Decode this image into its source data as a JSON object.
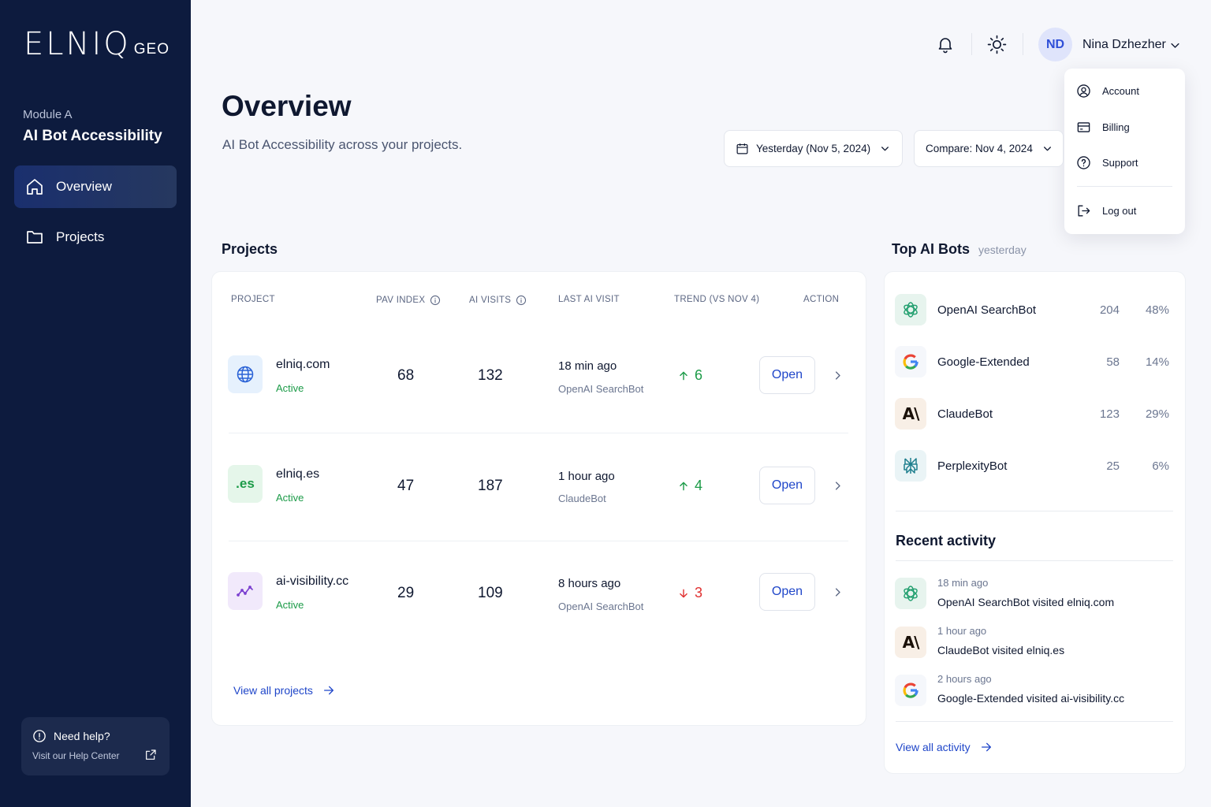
{
  "brand": {
    "logo_main": "ELNIQ",
    "logo_sub": "GEO"
  },
  "sidebar": {
    "module_label": "Module A",
    "module_title": "AI Bot Accessibility",
    "items": [
      {
        "label": "Overview",
        "icon": "home-icon",
        "active": true
      },
      {
        "label": "Projects",
        "icon": "folder-icon",
        "active": false
      }
    ],
    "help": {
      "title": "Need help?",
      "subtitle": "Visit our Help Center"
    }
  },
  "header": {
    "user_initials": "ND",
    "user_name": "Nina Dzhezher",
    "menu": [
      {
        "label": "Account",
        "icon": "user-circle-icon"
      },
      {
        "label": "Billing",
        "icon": "credit-card-icon"
      },
      {
        "label": "Support",
        "icon": "help-circle-icon"
      },
      {
        "label": "Log out",
        "icon": "logout-icon"
      }
    ]
  },
  "page": {
    "title": "Overview",
    "subtitle": "AI Bot Accessibility across your projects.",
    "date_selector": "Yesterday (Nov 5, 2024)",
    "compare_selector": "Compare: Nov 4, 2024"
  },
  "projects": {
    "title": "Projects",
    "columns": [
      "PROJECT",
      "PAV INDEX",
      "AI VISITS",
      "LAST AI VISIT",
      "TREND (VS NOV 4)",
      "ACTION"
    ],
    "rows": [
      {
        "name": "elniq.com",
        "status": "Active",
        "pav_index": "68",
        "ai_visits": "132",
        "last_visit": "18 min ago",
        "last_bot": "OpenAI SearchBot",
        "trend": "6",
        "trend_dir": "up",
        "action": "Open",
        "icon": "globe-icon",
        "icon_text": ""
      },
      {
        "name": "elniq.es",
        "status": "Active",
        "pav_index": "47",
        "ai_visits": "187",
        "last_visit": "1 hour ago",
        "last_bot": "ClaudeBot",
        "trend": "4",
        "trend_dir": "up",
        "action": "Open",
        "icon": "es-icon",
        "icon_text": ".es"
      },
      {
        "name": "ai-visibility.cc",
        "status": "Active",
        "pav_index": "29",
        "ai_visits": "109",
        "last_visit": "8 hours ago",
        "last_bot": "OpenAI SearchBot",
        "trend": "3",
        "trend_dir": "down",
        "action": "Open",
        "icon": "trend-line-icon",
        "icon_text": ""
      }
    ],
    "view_all": "View all projects"
  },
  "top_bots": {
    "title": "Top AI Bots",
    "hint": "yesterday",
    "rows": [
      {
        "name": "OpenAI SearchBot",
        "count": "204",
        "pct": "48%",
        "icon": "openai-icon"
      },
      {
        "name": "Google-Extended",
        "count": "58",
        "pct": "14%",
        "icon": "google-icon"
      },
      {
        "name": "ClaudeBot",
        "count": "123",
        "pct": "29%",
        "icon": "anthropic-icon",
        "icon_text": "A\\"
      },
      {
        "name": "PerplexityBot",
        "count": "25",
        "pct": "6%",
        "icon": "perplexity-icon"
      }
    ]
  },
  "recent_activity": {
    "title": "Recent activity",
    "items": [
      {
        "time": "18 min ago",
        "text": "OpenAI SearchBot visited elniq.com",
        "icon": "openai-icon"
      },
      {
        "time": "1 hour ago",
        "text": "ClaudeBot visited elniq.es",
        "icon": "anthropic-icon",
        "icon_text": "A\\"
      },
      {
        "time": "2 hours ago",
        "text": "Google-Extended visited ai-visibility.cc",
        "icon": "google-icon"
      }
    ],
    "view_all": "View all activity"
  },
  "colors": {
    "sidebar_bg": "#0d1b3e",
    "accent": "#1f46c9",
    "positive": "#1c9b48",
    "negative": "#e03131"
  }
}
